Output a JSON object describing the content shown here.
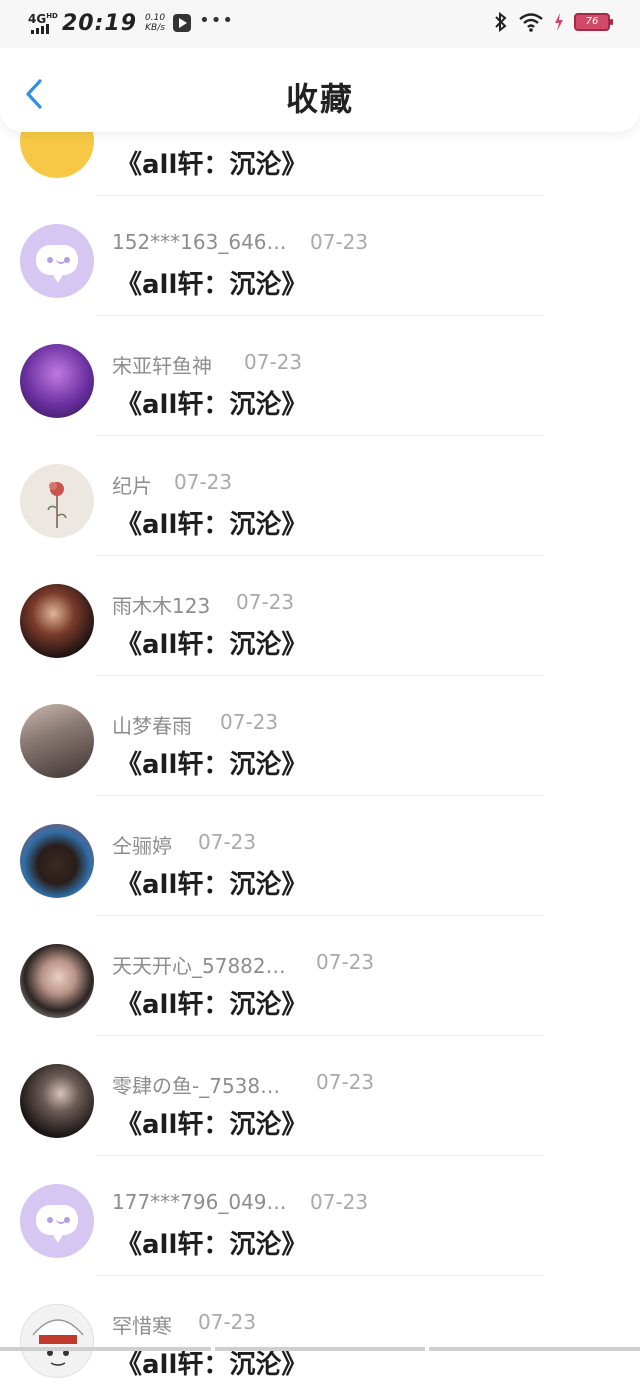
{
  "status_bar": {
    "network": "4G",
    "network_sup": "HD",
    "time": "20:19",
    "speed_value": "0.10",
    "speed_unit": "KB/s",
    "more": "•••",
    "battery": "76"
  },
  "header": {
    "title": "收藏"
  },
  "rows": [
    {
      "name": "",
      "date": "",
      "msg": "《all轩：沉沦》",
      "avatar_color": "#f6c845"
    },
    {
      "name": "152***163_646…",
      "date": "07-23",
      "msg": "《all轩：沉沦》",
      "avatar_color": "#d6c6f2"
    },
    {
      "name": "宋亚轩鱼神",
      "date": "07-23",
      "msg": "《all轩：沉沦》",
      "avatar_color": "#6a2fa0"
    },
    {
      "name": "纪片",
      "date": "07-23",
      "msg": "《all轩：沉沦》",
      "avatar_color": "#ede7e2"
    },
    {
      "name": "雨木木123",
      "date": "07-23",
      "msg": "《all轩：沉沦》",
      "avatar_color": "#3b1d1f"
    },
    {
      "name": "山梦春雨",
      "date": "07-23",
      "msg": "《all轩：沉沦》",
      "avatar_color": "#8a7a74"
    },
    {
      "name": "仝骊婷",
      "date": "07-23",
      "msg": "《all轩：沉沦》",
      "avatar_color": "#2f6fa8"
    },
    {
      "name": "天天开心_57882…",
      "date": "07-23",
      "msg": "《all轩：沉沦》",
      "avatar_color": "#6b5b56"
    },
    {
      "name": "零肆の鱼-_7538…",
      "date": "07-23",
      "msg": "《all轩：沉沦》",
      "avatar_color": "#2a2522"
    },
    {
      "name": "177***796_049…",
      "date": "07-23",
      "msg": "《all轩：沉沦》",
      "avatar_color": "#d6c6f2"
    },
    {
      "name": "罕惜寒",
      "date": "07-23",
      "msg": "《all轩：沉沦》",
      "avatar_color": "#e4e4e4"
    }
  ]
}
